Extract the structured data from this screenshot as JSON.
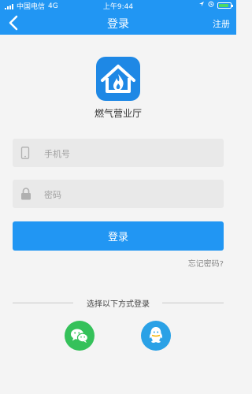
{
  "status_bar": {
    "carrier": "中国电信",
    "network": "4G",
    "time": "上午9:44"
  },
  "nav": {
    "title": "登录",
    "register_label": "注册"
  },
  "app": {
    "name": "燃气营业厅"
  },
  "form": {
    "phone_placeholder": "手机号",
    "password_placeholder": "密码",
    "login_label": "登录",
    "forgot_label": "忘记密码?"
  },
  "social": {
    "divider_text": "选择以下方式登录",
    "options": [
      "wechat",
      "qq"
    ]
  },
  "colors": {
    "primary": "#2196f3",
    "wechat": "#35c15a",
    "qq": "#2aa1e6"
  }
}
